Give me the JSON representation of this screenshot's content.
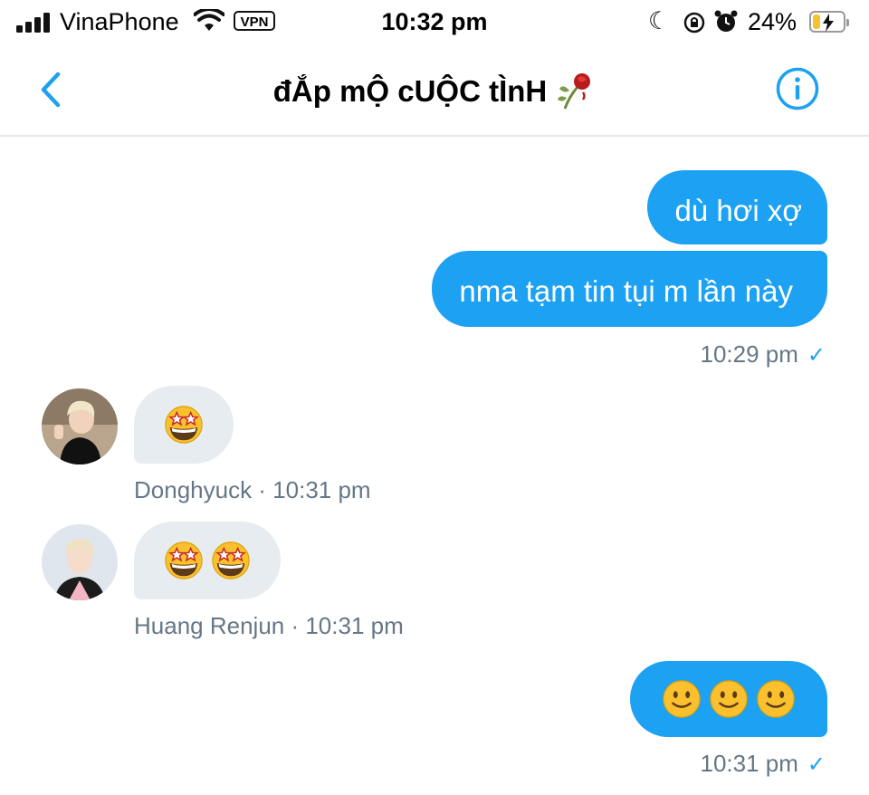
{
  "status_bar": {
    "carrier": "VinaPhone",
    "vpn_label": "VPN",
    "time": "10:32 pm",
    "battery_percent": "24%",
    "battery_level": 0.24
  },
  "header": {
    "title": "đẮp mỘ cUỘC tÌnH",
    "back_icon": "chevron-left-icon",
    "info_icon": "info-icon",
    "accent_color": "#1da1f2"
  },
  "messages": [
    {
      "direction": "outgoing",
      "text": "dù hơi xợ"
    },
    {
      "direction": "outgoing",
      "text": "nma tạm tin tụi m lần này",
      "meta": "10:29 pm",
      "read_icon": "✓"
    },
    {
      "direction": "incoming",
      "sender": "Donghyuck",
      "content": "star-struck-emoji x1",
      "meta": "Donghyuck · 10:31 pm"
    },
    {
      "direction": "incoming",
      "sender": "Huang Renjun",
      "content": "star-struck-emoji x2",
      "meta": "Huang Renjun · 10:31 pm"
    },
    {
      "direction": "outgoing",
      "content": "slightly-smiling-emoji x3",
      "meta": "10:31 pm",
      "read_icon": "✓"
    }
  ],
  "colors": {
    "outgoing_bubble": "#1da1f2",
    "incoming_bubble": "#e6ecf0",
    "meta_text": "#657786"
  }
}
